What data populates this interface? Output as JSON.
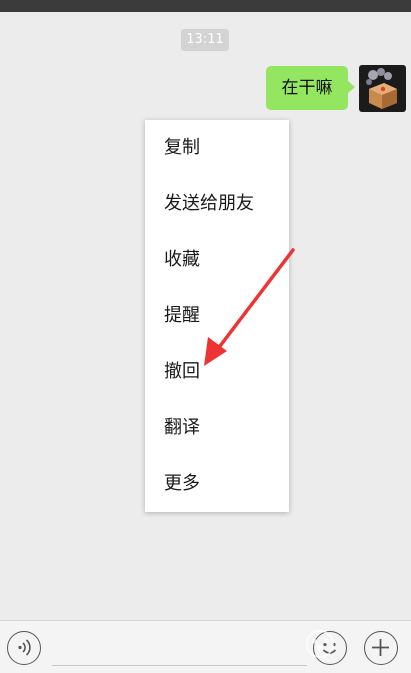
{
  "chat": {
    "timestamp": "13:11",
    "message": "在干嘛"
  },
  "context_menu": {
    "items": [
      {
        "label": "复制"
      },
      {
        "label": "发送给朋友"
      },
      {
        "label": "收藏"
      },
      {
        "label": "提醒"
      },
      {
        "label": "撤回"
      },
      {
        "label": "翻译"
      },
      {
        "label": "更多"
      }
    ]
  },
  "annotation": {
    "arrow_color": "#ee3333"
  },
  "icons": {
    "voice": "voice-icon",
    "emoji": "emoji-icon",
    "plus": "plus-icon"
  },
  "colors": {
    "bubble": "#94e55f",
    "background": "#ececec"
  }
}
